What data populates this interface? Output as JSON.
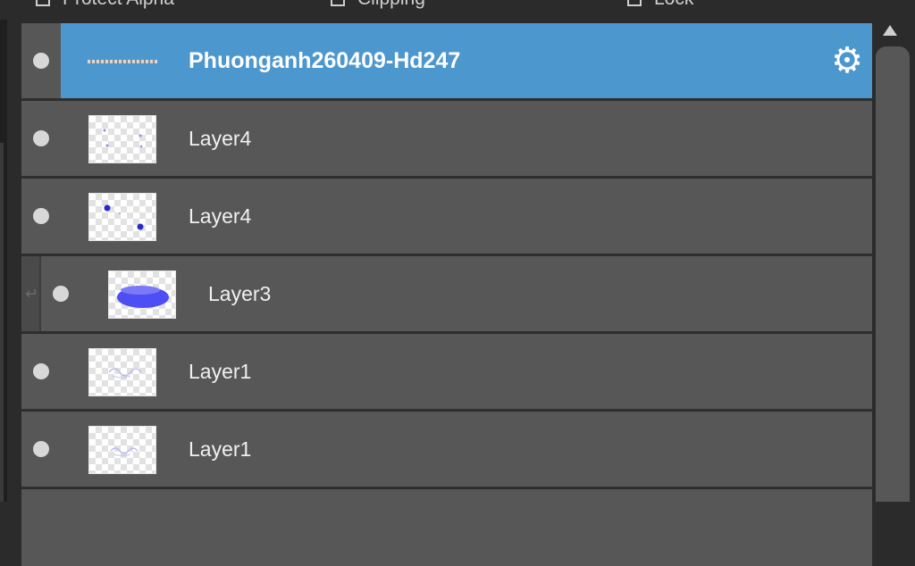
{
  "options": {
    "protect_alpha": "Protect Alpha",
    "clipping": "Clipping",
    "lock": "Lock"
  },
  "layers": [
    {
      "name": "Phuonganh260409-Hd247",
      "type": "folder",
      "selected": true,
      "icon": "gear-icon"
    },
    {
      "name": "Layer4",
      "type": "layer"
    },
    {
      "name": "Layer4",
      "type": "layer"
    },
    {
      "name": "Layer3",
      "type": "layer",
      "clipped": true
    },
    {
      "name": "Layer1",
      "type": "layer"
    },
    {
      "name": "Layer1",
      "type": "layer"
    }
  ],
  "colors": {
    "selected": "#4d97cf",
    "row": "#575757",
    "background": "#2b2b2b"
  }
}
